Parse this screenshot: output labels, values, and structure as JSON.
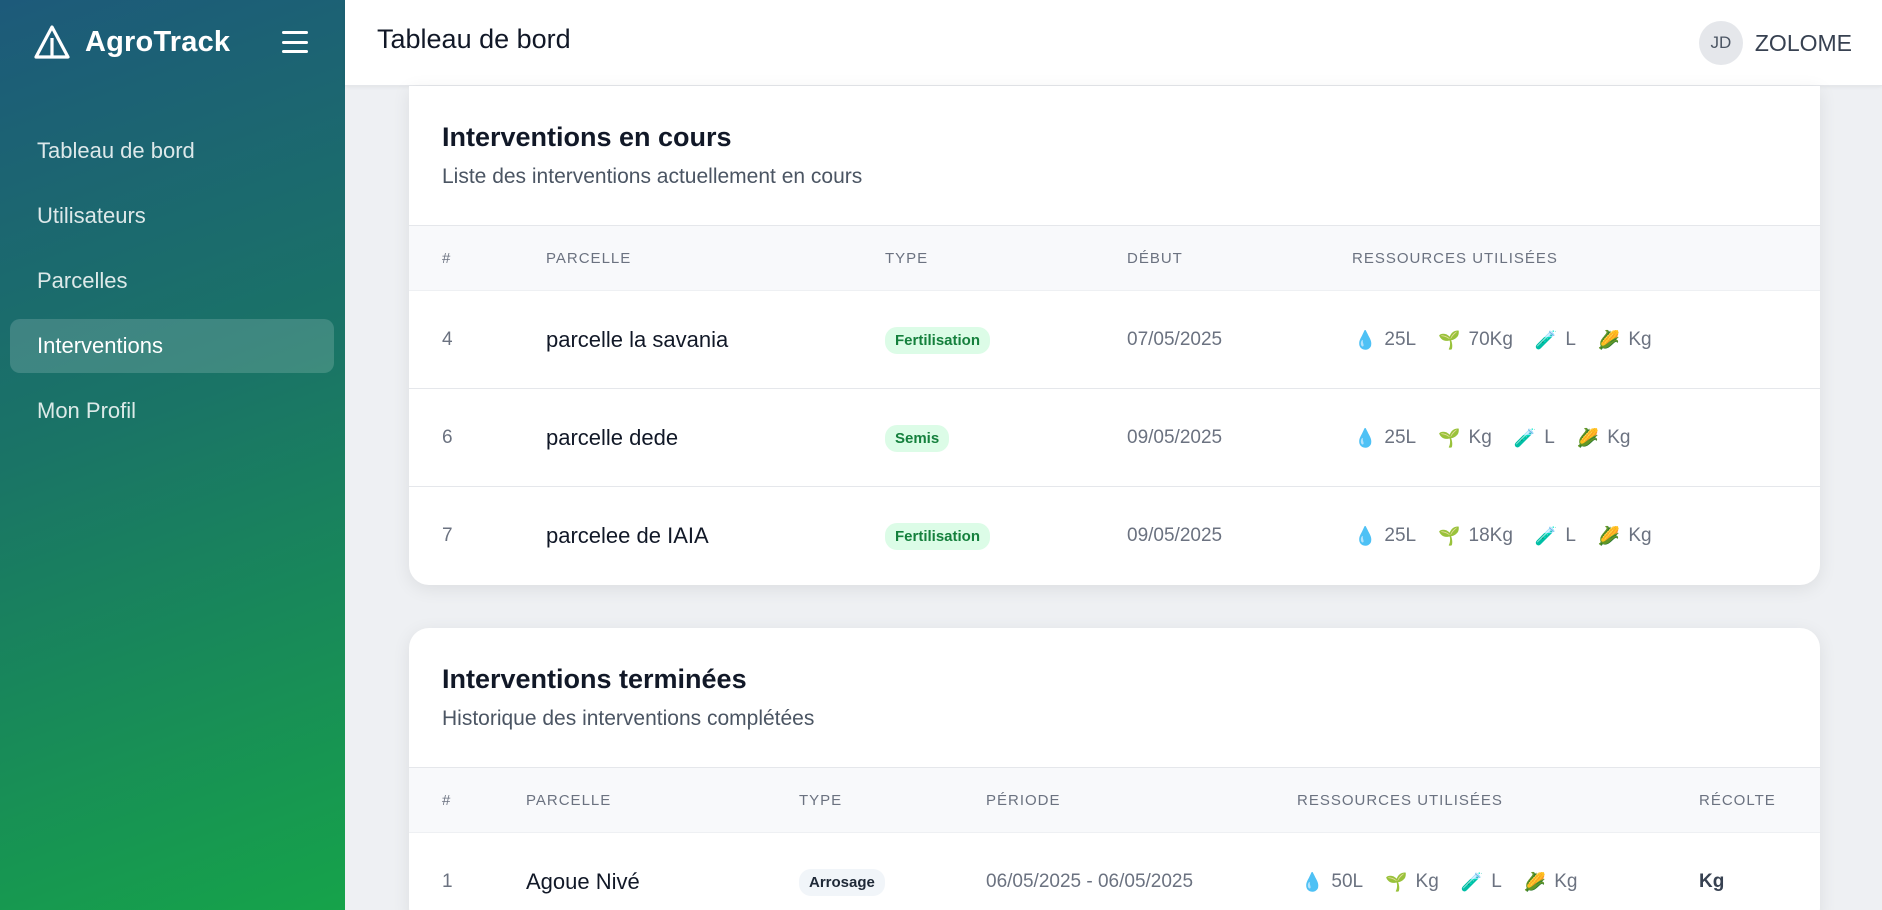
{
  "app": {
    "name": "AgroTrack"
  },
  "sidebar": {
    "items": [
      {
        "label": "Tableau de bord",
        "active": false
      },
      {
        "label": "Utilisateurs",
        "active": false
      },
      {
        "label": "Parcelles",
        "active": false
      },
      {
        "label": "Interventions",
        "active": true
      },
      {
        "label": "Mon Profil",
        "active": false
      }
    ]
  },
  "header": {
    "title": "Tableau de bord",
    "avatar_initials": "JD",
    "username": "ZOLOME"
  },
  "in_progress": {
    "title": "Interventions en cours",
    "subtitle": "Liste des interventions actuellement en cours",
    "columns": [
      "#",
      "PARCELLE",
      "TYPE",
      "DÉBUT",
      "RESSOURCES UTILISÉES"
    ],
    "rows": [
      {
        "id": "4",
        "parcelle": "parcelle la savania",
        "type": "Fertilisation",
        "debut": "07/05/2025",
        "eau": "25L",
        "semence": "70Kg",
        "produit": "L",
        "recolte": "Kg"
      },
      {
        "id": "6",
        "parcelle": "parcelle dede",
        "type": "Semis",
        "debut": "09/05/2025",
        "eau": "25L",
        "semence": "Kg",
        "produit": "L",
        "recolte": "Kg"
      },
      {
        "id": "7",
        "parcelle": "parcelee de IAIA",
        "type": "Fertilisation",
        "debut": "09/05/2025",
        "eau": "25L",
        "semence": "18Kg",
        "produit": "L",
        "recolte": "Kg"
      }
    ]
  },
  "completed": {
    "title": "Interventions terminées",
    "subtitle": "Historique des interventions complétées",
    "columns": [
      "#",
      "PARCELLE",
      "TYPE",
      "PÉRIODE",
      "RESSOURCES UTILISÉES",
      "RÉCOLTE"
    ],
    "rows": [
      {
        "id": "1",
        "parcelle": "Agoue Nivé",
        "type": "Arrosage",
        "periode": "06/05/2025 - 06/05/2025",
        "eau": "50L",
        "semence": "Kg",
        "produit": "L",
        "recolte_res": "Kg",
        "recolte": "Kg"
      }
    ]
  },
  "icons": {
    "water": "droplet-icon",
    "seed": "seedling-icon",
    "product": "syringe-icon",
    "harvest": "corn-icon",
    "menu": "hamburger-icon",
    "logo": "triangle-logo-icon"
  },
  "colors": {
    "accent": "#16a34a",
    "badge_green_bg": "#dcfce7",
    "badge_green_text": "#15803d"
  }
}
